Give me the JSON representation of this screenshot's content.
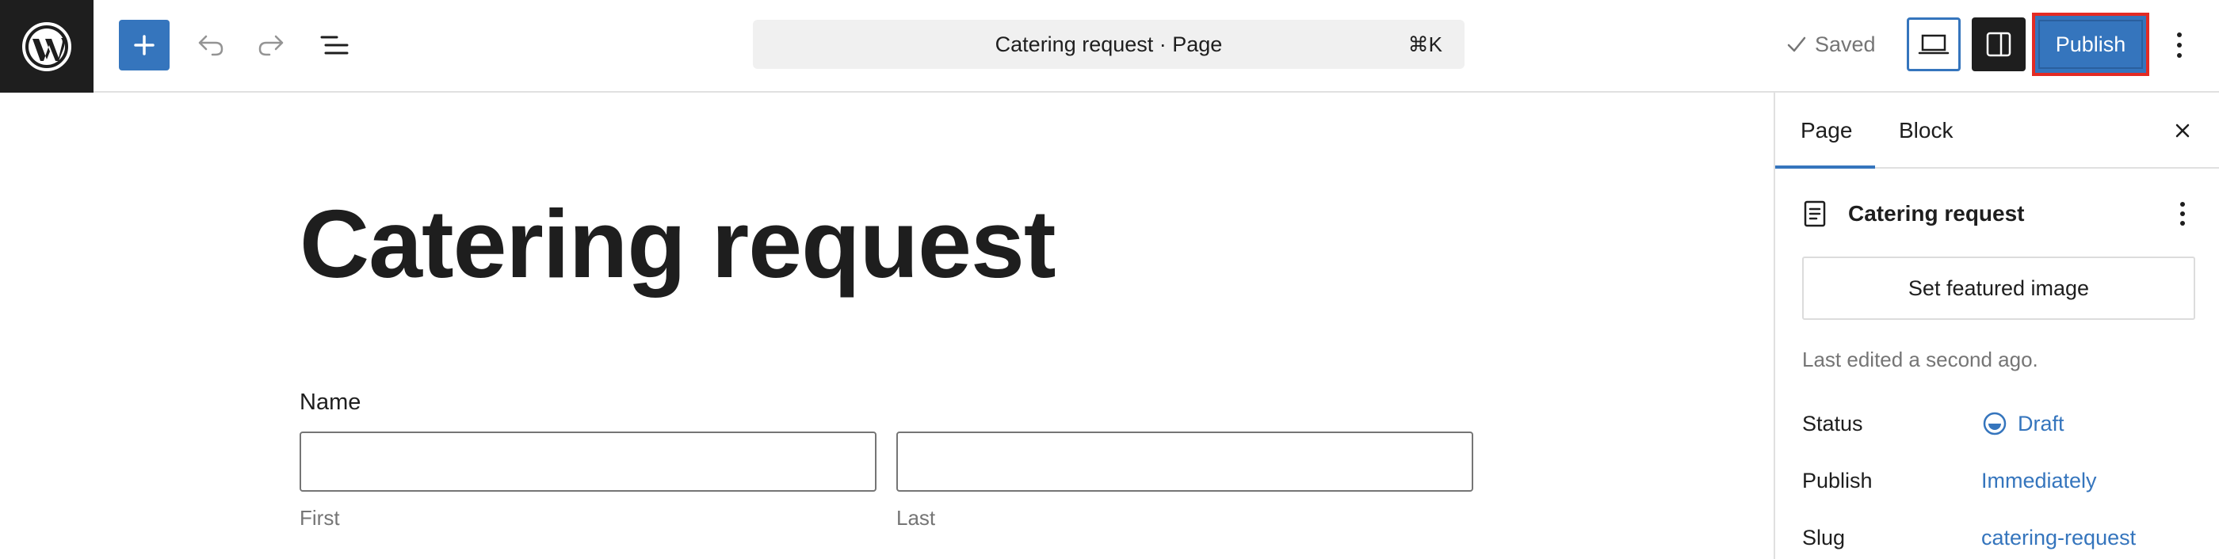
{
  "toolbar": {
    "document_title": "Catering request · Page",
    "shortcut": "⌘K",
    "saved_label": "Saved",
    "publish_label": "Publish"
  },
  "editor": {
    "page_title": "Catering request",
    "name_field": {
      "label": "Name",
      "first_value": "",
      "last_value": "",
      "first_sublabel": "First",
      "last_sublabel": "Last"
    }
  },
  "sidebar": {
    "tabs": [
      {
        "label": "Page",
        "active": true
      },
      {
        "label": "Block",
        "active": false
      }
    ],
    "document": {
      "title": "Catering request"
    },
    "featured_image_label": "Set featured image",
    "last_edited": "Last edited a second ago.",
    "meta": {
      "status_label": "Status",
      "status_value": "Draft",
      "publish_label": "Publish",
      "publish_value": "Immediately",
      "slug_label": "Slug",
      "slug_value": "catering-request"
    }
  },
  "colors": {
    "accent": "#3575bd",
    "dark": "#1e1e1e",
    "highlight": "#e32b24",
    "muted": "#757575"
  },
  "icons": [
    "wordpress-logo-icon",
    "plus-icon",
    "undo-icon",
    "redo-icon",
    "list-view-icon",
    "check-icon",
    "desktop-view-icon",
    "sidebar-toggle-icon",
    "kebab-menu-icon",
    "close-icon",
    "document-icon",
    "draft-status-icon"
  ]
}
